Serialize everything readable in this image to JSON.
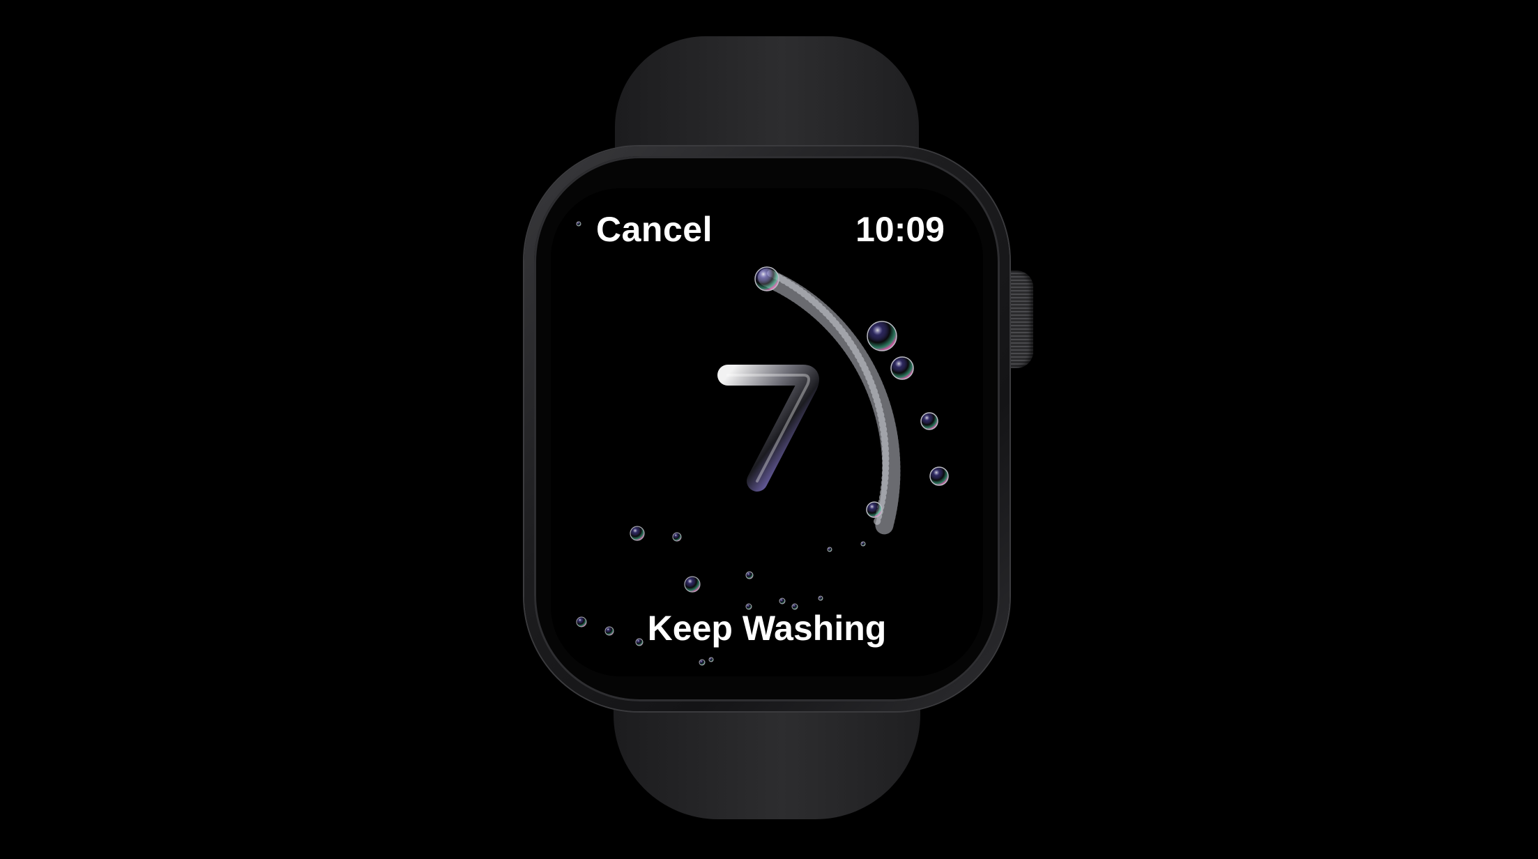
{
  "watch": {
    "header": {
      "cancel_label": "Cancel",
      "time": "10:09"
    },
    "countdown": {
      "value": "7"
    },
    "status_label": "Keep Washing",
    "icons": {
      "countdown_ring": "bubble-ring-icon",
      "bubbles": "soap-bubbles-icon",
      "crown": "digital-crown"
    },
    "colors": {
      "background": "#000000",
      "text": "#ffffff",
      "case": "#1d1d1f"
    }
  }
}
